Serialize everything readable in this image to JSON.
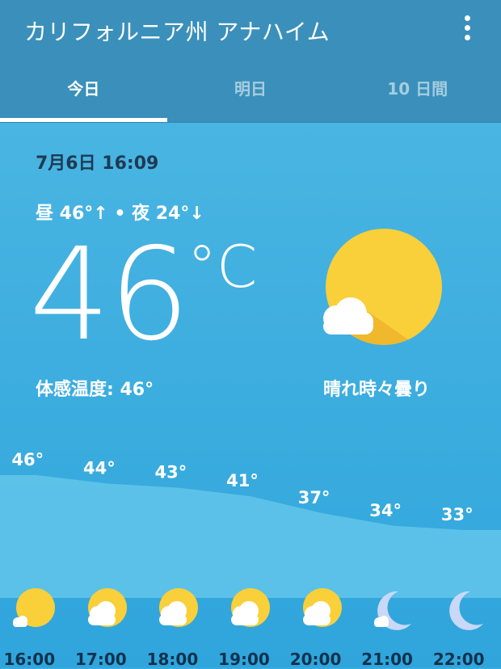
{
  "header": {
    "title": "カリフォルニア州 アナハイム"
  },
  "tabs": [
    {
      "label": "今日",
      "active": true
    },
    {
      "label": "明日",
      "active": false
    },
    {
      "label": "10 日間",
      "active": false
    }
  ],
  "current": {
    "datetime": "7月6日 16:09",
    "hilo": "昼 46°↑ • 夜 24°↓",
    "temperature": "46",
    "unit": "°C",
    "feels_like": "体感温度: 46°",
    "condition": "晴れ時々曇り",
    "icon": "partly-sunny-icon"
  },
  "colors": {
    "appbar": "#3a90ba",
    "background": "#38ace0",
    "sun": "#f9cf3a",
    "moon": "#c9d8f7"
  },
  "hourly": [
    {
      "time": "16:00",
      "temp": "46°",
      "value": 46,
      "icon": "sun-cloud-icon"
    },
    {
      "time": "17:00",
      "temp": "44°",
      "value": 44,
      "icon": "sun-cloud-icon"
    },
    {
      "time": "18:00",
      "temp": "43°",
      "value": 43,
      "icon": "sun-cloud-icon"
    },
    {
      "time": "19:00",
      "temp": "41°",
      "value": 41,
      "icon": "sun-cloud-icon"
    },
    {
      "time": "20:00",
      "temp": "37°",
      "value": 37,
      "icon": "sun-cloud-icon"
    },
    {
      "time": "21:00",
      "temp": "34°",
      "value": 34,
      "icon": "moon-cloud-icon"
    },
    {
      "time": "22:00",
      "temp": "33°",
      "value": 33,
      "icon": "moon-icon"
    }
  ]
}
